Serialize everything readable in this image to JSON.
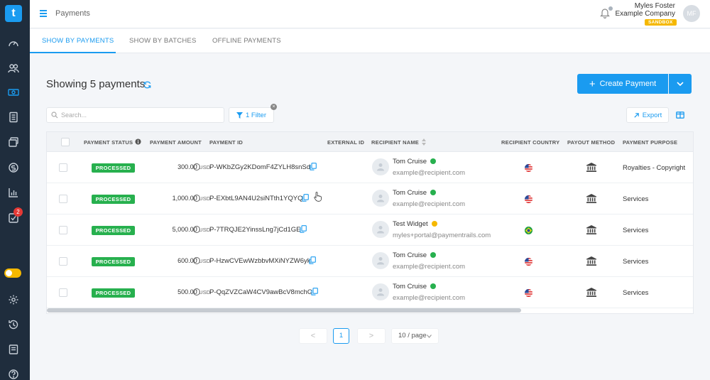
{
  "sidebar": {
    "logo": "t",
    "badge_count": "2"
  },
  "topbar": {
    "breadcrumb": "Payments",
    "user_name": "Myles Foster",
    "company": "Example Company",
    "env_badge": "SANDBOX",
    "avatar_initials": "MF"
  },
  "tabs": [
    {
      "label": "SHOW BY PAYMENTS"
    },
    {
      "label": "SHOW BY BATCHES"
    },
    {
      "label": "OFFLINE PAYMENTS"
    }
  ],
  "main": {
    "heading": "Showing 5 payments",
    "create_label": "Create Payment",
    "search_placeholder": "Search...",
    "filter_label": "1 Filter",
    "export_label": "Export"
  },
  "table": {
    "headers": {
      "status": "PAYMENT STATUS",
      "amount": "PAYMENT AMOUNT",
      "id": "PAYMENT ID",
      "external": "EXTERNAL ID",
      "recipient": "RECIPIENT NAME",
      "country": "RECIPIENT COUNTRY",
      "method": "PAYOUT METHOD",
      "purpose": "PAYMENT PURPOSE"
    },
    "rows": [
      {
        "status": "PROCESSED",
        "amount": "300.00",
        "currency": "USD",
        "id": "P-WKbZGy2KDomF4ZYLH8snSd",
        "name": "Tom Cruise",
        "email": "example@recipient.com",
        "dot_color": "#27b04e",
        "country": "us",
        "purpose": "Royalties - Copyright"
      },
      {
        "status": "PROCESSED",
        "amount": "1,000.00",
        "currency": "USD",
        "id": "P-EXbtL9AN4U2siNTth1YQYQ",
        "name": "Tom Cruise",
        "email": "example@recipient.com",
        "dot_color": "#27b04e",
        "country": "us",
        "purpose": "Services"
      },
      {
        "status": "PROCESSED",
        "amount": "5,000.00",
        "currency": "USD",
        "id": "P-7TRQJE2YinssLng7jCd1GE",
        "name": "Test Widget",
        "email": "myles+portal@paymentrails.com",
        "dot_color": "#f5b800",
        "country": "br",
        "purpose": "Services"
      },
      {
        "status": "PROCESSED",
        "amount": "600.00",
        "currency": "USD",
        "id": "P-HzwCVEwWzbbvMXiNYZW6yk",
        "name": "Tom Cruise",
        "email": "example@recipient.com",
        "dot_color": "#27b04e",
        "country": "us",
        "purpose": "Services"
      },
      {
        "status": "PROCESSED",
        "amount": "500.00",
        "currency": "USD",
        "id": "P-QqZVZCaW4CV9awBcV8mchG",
        "name": "Tom Cruise",
        "email": "example@recipient.com",
        "dot_color": "#27b04e",
        "country": "us",
        "purpose": "Services"
      }
    ]
  },
  "pagination": {
    "prev": "<",
    "current": "1",
    "next": ">",
    "page_size": "10 / page"
  },
  "colors": {
    "accent": "#1a9bf0",
    "success": "#27b04e",
    "warning": "#f5b800",
    "sidebar": "#1f2d3d"
  }
}
